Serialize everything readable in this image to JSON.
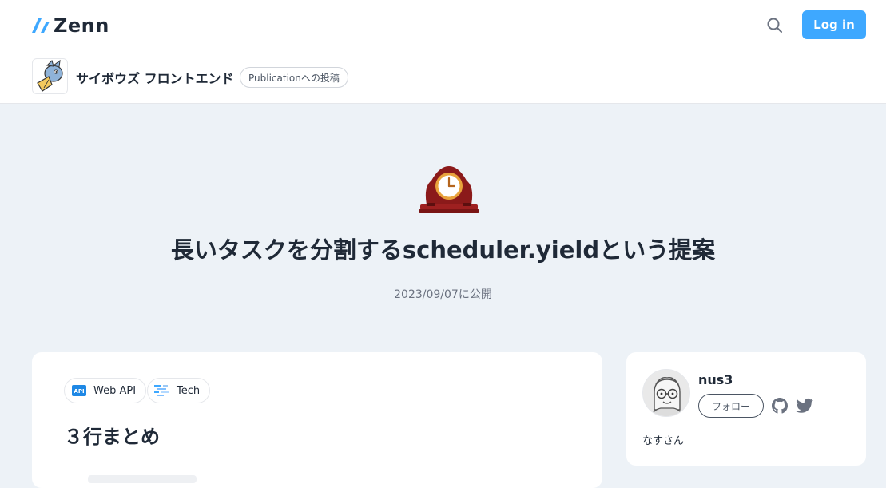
{
  "header": {
    "logo_text": "Zenn",
    "login_label": "Log in"
  },
  "publication": {
    "name": "サイボウズ フロントエンド",
    "badge": "Publicationへの投稿"
  },
  "article": {
    "title": "長いタスクを分割するscheduler.yieldという提案",
    "date": "2023/09/07に公開",
    "topics": [
      {
        "label": "Web API",
        "icon": "api-icon"
      },
      {
        "label": "Tech",
        "icon": "tech-icon"
      }
    ],
    "heading": "３行まとめ"
  },
  "author": {
    "name": "nus3",
    "follow_label": "フォロー",
    "bio": "なすさん"
  },
  "colors": {
    "accent": "#3ea8ff",
    "background": "#edf2f7"
  }
}
